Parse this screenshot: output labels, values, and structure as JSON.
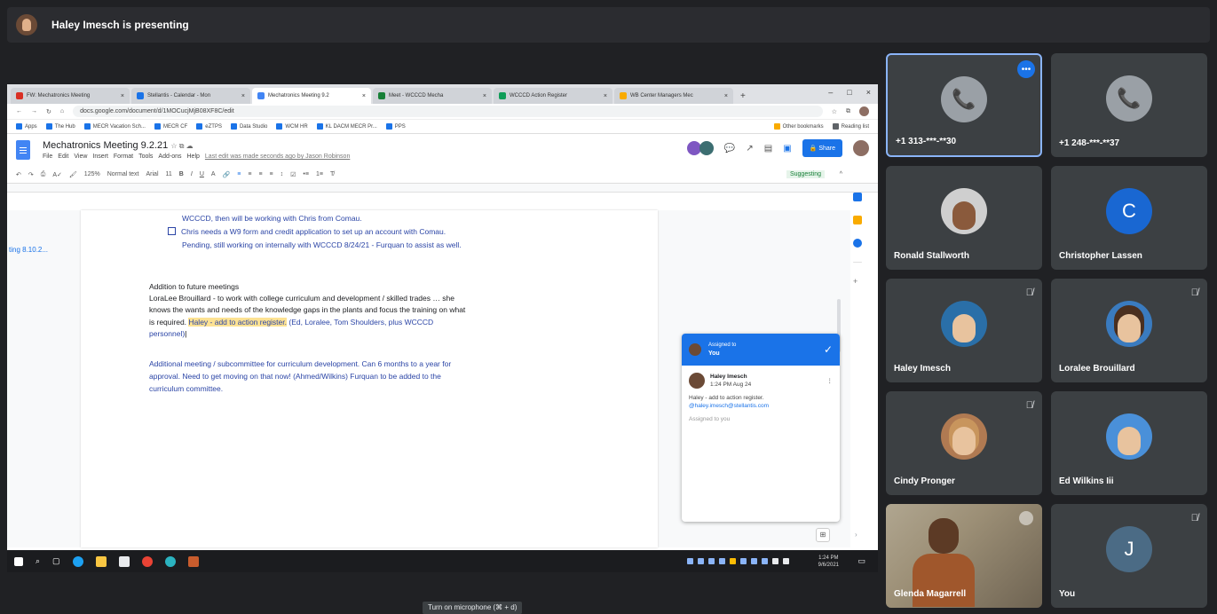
{
  "presenting": {
    "text": "Haley Imesch is presenting"
  },
  "browser": {
    "tabs": [
      {
        "label": "FW: Mechatronics Meeting",
        "color": "#d93025"
      },
      {
        "label": "Stellantis - Calendar - Mon",
        "color": "#1a73e8"
      },
      {
        "label": "Mechatronics Meeting 9.2",
        "color": "#4285f4",
        "active": true
      },
      {
        "label": "Meet - WCCCD Mecha",
        "color": "#188038"
      },
      {
        "label": "WCCCD Action Register",
        "color": "#0f9d58"
      },
      {
        "label": "WB Center Managers Mec",
        "color": "#f9ab00"
      }
    ],
    "url": "docs.google.com/document/d/1MOCucjMjB08XF8C/edit",
    "bookmarks": [
      "Apps",
      "The Hub",
      "MECR Vacation Sch...",
      "MECR CF",
      "eZTPS",
      "Data Studio",
      "WCM HR",
      "KL DACM MECR Pr...",
      "PPS"
    ],
    "bookmarks_right": [
      "Other bookmarks",
      "Reading list"
    ]
  },
  "doc": {
    "title": "Mechatronics Meeting 9.2.21",
    "menu": [
      "File",
      "Edit",
      "View",
      "Insert",
      "Format",
      "Tools",
      "Add-ons",
      "Help"
    ],
    "last_edit": "Last edit was made seconds ago by Jason Robinson",
    "share": "Share",
    "zoom": "125%",
    "style": "Normal text",
    "font": "Arial",
    "size": "11",
    "mode": "Suggesting",
    "outline_link": "ting 8.10.2...",
    "lines": {
      "l1": "WCCCD, then will be working with Chris from Comau.",
      "l2": "Chris needs a W9 form and credit application to set up an account with Comau.",
      "l3": "Pending, still working on internally with WCCCD 8/24/21 - Furquan to assist as well.",
      "l4": "Addition to future meetings",
      "l5": "LoraLee Brouillard - to work with college curriculum and development / skilled trades … she",
      "l6": "knows the wants and needs of the knowledge gaps in the plants and focus the training on what",
      "l7a": "is required.",
      "l7b": "Haley - add to action register.",
      "l7c": "(Ed, Loralee, Tom Shoulders, plus WCCCD",
      "l8": "personnel)",
      "l9": "Additional meeting / subcommittee for curriculum development. Can 6 months to a year for",
      "l10": "approval. Need to get moving on that now! (Ahmed/Wilkins) Furquan to be added to the",
      "l11": "curriculum committee."
    },
    "comment": {
      "assigned_label": "Assigned to",
      "assigned_to": "You",
      "author": "Haley Imesch",
      "time": "1:24 PM Aug 24",
      "text": "Haley - add to action register.",
      "mention": "@haley.imesch@stellantis.com",
      "footer": "Assigned to you"
    }
  },
  "taskbar": {
    "time": "1:24 PM",
    "date": "9/6/2021"
  },
  "participants": [
    {
      "name": "+1 313-***-**30",
      "kind": "phone",
      "selected": true
    },
    {
      "name": "+1 248-***-**37",
      "kind": "phone"
    },
    {
      "name": "Ronald Stallworth",
      "kind": "photo"
    },
    {
      "name": "Christopher Lassen",
      "kind": "letter",
      "initial": "C"
    },
    {
      "name": "Haley Imesch",
      "kind": "photo",
      "muted": true
    },
    {
      "name": "Loralee Brouillard",
      "kind": "photo",
      "muted": true
    },
    {
      "name": "Cindy Pronger",
      "kind": "photo",
      "muted": true
    },
    {
      "name": "Ed Wilkins Iii",
      "kind": "photo"
    },
    {
      "name": "Glenda Magarrell",
      "kind": "video"
    },
    {
      "name": "You",
      "kind": "letter",
      "initial": "J",
      "muted": true
    }
  ],
  "tooltip": {
    "text": "Turn on microphone (⌘ + d)"
  },
  "colors": {
    "accent": "#1a73e8",
    "tile": "#3c4043",
    "background": "#202124"
  }
}
